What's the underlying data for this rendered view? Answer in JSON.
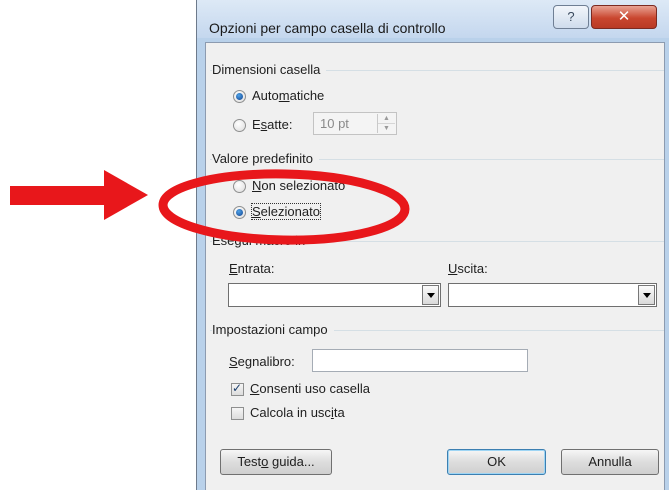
{
  "window": {
    "title": "Opzioni per campo casella di controllo",
    "help_label": "?",
    "close_label": "✕"
  },
  "size_group": {
    "label": "Dimensioni casella",
    "auto": {
      "pre": "Auto",
      "acc": "m",
      "post": "atiche",
      "checked": true
    },
    "exact": {
      "pre": "E",
      "acc": "s",
      "post": "atte:",
      "checked": false
    },
    "exact_value": "10 pt"
  },
  "default_group": {
    "label": "Valore predefinito",
    "not_selected": {
      "pre": "",
      "acc": "N",
      "post": "on selezionato",
      "checked": false
    },
    "selected": {
      "pre": "",
      "acc": "S",
      "post": "elezionato",
      "checked": true
    }
  },
  "macro_group": {
    "label": "Esegui macro in",
    "entry": {
      "pre": "",
      "acc": "E",
      "post": "ntrata:",
      "value": ""
    },
    "exit": {
      "pre": "",
      "acc": "U",
      "post": "scita:",
      "value": ""
    }
  },
  "field_group": {
    "label": "Impostazioni campo",
    "bookmark": {
      "pre": "",
      "acc": "S",
      "post": "egnalibro:",
      "value": ""
    },
    "enable": {
      "pre": "",
      "acc": "C",
      "post": "onsenti uso casella",
      "checked": true
    },
    "calc": {
      "pre": "Calcola in usc",
      "acc": "i",
      "post": "ta",
      "checked": false
    }
  },
  "buttons": {
    "help_text": {
      "pre": "Test",
      "acc": "o",
      "post": " guida..."
    },
    "ok": "OK",
    "cancel": "Annulla"
  },
  "colors": {
    "annotation": "#e8171b",
    "window_frame": "#b9d1ea",
    "close_button": "#c9462f"
  }
}
